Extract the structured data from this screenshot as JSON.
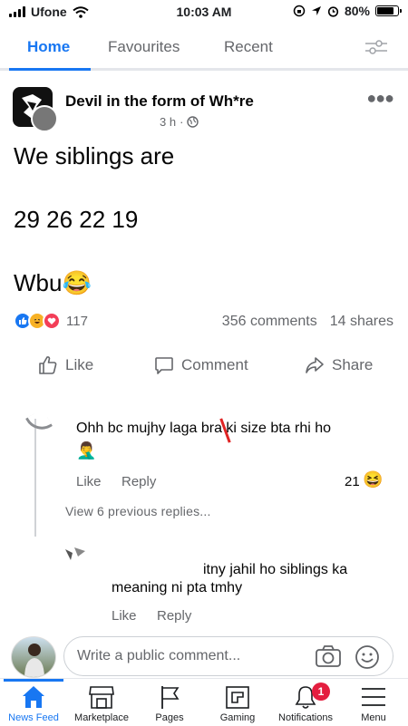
{
  "status_bar": {
    "carrier": "Ufone",
    "time": "10:03 AM",
    "battery": "80%",
    "battery_level": 0.8
  },
  "top_tabs": [
    "Home",
    "Favourites",
    "Recent"
  ],
  "post": {
    "author": "Devil in the form of Wh*re",
    "time": "3 h",
    "text_line1": "We siblings are",
    "text_line2": "29 26 22 19",
    "text_line3": "Wbu😂",
    "reaction_count": "117",
    "comments": "356 comments",
    "shares": "14 shares"
  },
  "actions": {
    "like": "Like",
    "comment": "Comment",
    "share": "Share"
  },
  "comments": [
    {
      "text": "Ohh bc mujhy laga bra ki size bta rhi ho",
      "emoji": "🤦‍♂️",
      "like": "Like",
      "reply": "Reply",
      "reaction_count": "21",
      "reaction_emoji": "😆"
    }
  ],
  "view_replies": "View 6 previous replies...",
  "reply": {
    "text_line1": "itny jahil ho siblings ka",
    "text_line2": "meaning ni pta tmhy",
    "like": "Like",
    "reply": "Reply"
  },
  "composer": {
    "placeholder": "Write a public comment..."
  },
  "bottom_nav": [
    {
      "label": "News Feed",
      "icon": "home-icon"
    },
    {
      "label": "Marketplace",
      "icon": "marketplace-icon"
    },
    {
      "label": "Pages",
      "icon": "flag-icon"
    },
    {
      "label": "Gaming",
      "icon": "gaming-icon"
    },
    {
      "label": "Notifications",
      "icon": "bell-icon",
      "badge": "1"
    },
    {
      "label": "Menu",
      "icon": "menu-icon"
    }
  ],
  "colors": {
    "accent": "#1877f2",
    "badge": "#e41e3f",
    "muted": "#65676b"
  }
}
